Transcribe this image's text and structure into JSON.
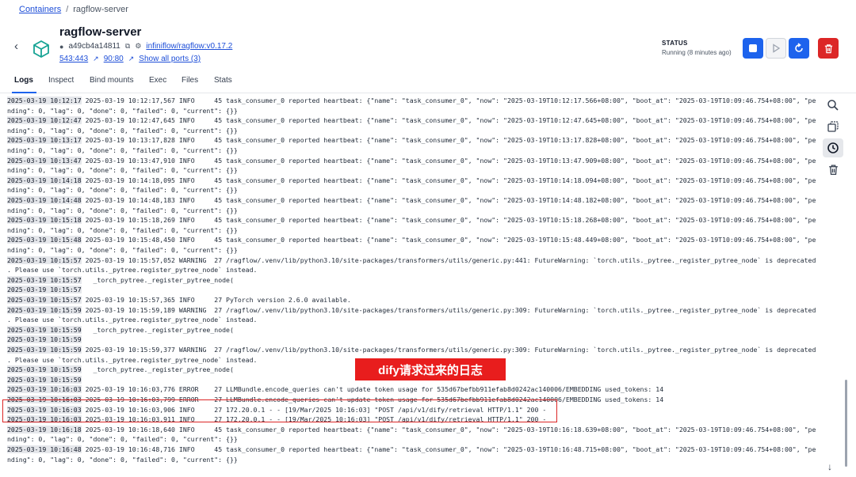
{
  "breadcrumb": {
    "parent": "Containers",
    "separator": "/",
    "current": "ragflow-server"
  },
  "header": {
    "title": "ragflow-server",
    "container_id": "a49cb4a14811",
    "image_link": "infiniflow/ragflow:v0.17.2",
    "port_1": "543:443",
    "port_2": "90:80",
    "show_all_ports": "Show all ports (3)"
  },
  "status": {
    "label": "STATUS",
    "value": "Running (8 minutes ago)"
  },
  "colors": {
    "primary": "#1d63ed",
    "danger": "#dc2626",
    "annotation_bg": "#e81d1d"
  },
  "tabs": [
    {
      "label": "Logs"
    },
    {
      "label": "Inspect"
    },
    {
      "label": "Bind mounts"
    },
    {
      "label": "Exec"
    },
    {
      "label": "Files"
    },
    {
      "label": "Stats"
    }
  ],
  "toolbar_icons": [
    "search-icon",
    "copy-icon",
    "clock-icon",
    "trash-icon"
  ],
  "annotation": "dify请求过来的日志",
  "logs": [
    {
      "ts": "2025-03-19 10:12:17",
      "text": " 2025-03-19 10:12:17,567 INFO     45 task_consumer_0 reported heartbeat: {\"name\": \"task_consumer_0\", \"now\": \"2025-03-19T10:12:17.566+08:00\", \"boot_at\": \"2025-03-19T10:09:46.754+08:00\", \"pe"
    },
    {
      "ts": "",
      "text": "nding\": 0, \"lag\": 0, \"done\": 0, \"failed\": 0, \"current\": {}}"
    },
    {
      "ts": "2025-03-19 10:12:47",
      "text": " 2025-03-19 10:12:47,645 INFO     45 task_consumer_0 reported heartbeat: {\"name\": \"task_consumer_0\", \"now\": \"2025-03-19T10:12:47.645+08:00\", \"boot_at\": \"2025-03-19T10:09:46.754+08:00\", \"pe"
    },
    {
      "ts": "",
      "text": "nding\": 0, \"lag\": 0, \"done\": 0, \"failed\": 0, \"current\": {}}"
    },
    {
      "ts": "2025-03-19 10:13:17",
      "text": " 2025-03-19 10:13:17,828 INFO     45 task_consumer_0 reported heartbeat: {\"name\": \"task_consumer_0\", \"now\": \"2025-03-19T10:13:17.828+08:00\", \"boot_at\": \"2025-03-19T10:09:46.754+08:00\", \"pe"
    },
    {
      "ts": "",
      "text": "nding\": 0, \"lag\": 0, \"done\": 0, \"failed\": 0, \"current\": {}}"
    },
    {
      "ts": "2025-03-19 10:13:47",
      "text": " 2025-03-19 10:13:47,910 INFO     45 task_consumer_0 reported heartbeat: {\"name\": \"task_consumer_0\", \"now\": \"2025-03-19T10:13:47.909+08:00\", \"boot_at\": \"2025-03-19T10:09:46.754+08:00\", \"pe"
    },
    {
      "ts": "",
      "text": "nding\": 0, \"lag\": 0, \"done\": 0, \"failed\": 0, \"current\": {}}"
    },
    {
      "ts": "2025-03-19 10:14:18",
      "text": " 2025-03-19 10:14:18,095 INFO     45 task_consumer_0 reported heartbeat: {\"name\": \"task_consumer_0\", \"now\": \"2025-03-19T10:14:18.094+08:00\", \"boot_at\": \"2025-03-19T10:09:46.754+08:00\", \"pe"
    },
    {
      "ts": "",
      "text": "nding\": 0, \"lag\": 0, \"done\": 0, \"failed\": 0, \"current\": {}}"
    },
    {
      "ts": "2025-03-19 10:14:48",
      "text": " 2025-03-19 10:14:48,183 INFO     45 task_consumer_0 reported heartbeat: {\"name\": \"task_consumer_0\", \"now\": \"2025-03-19T10:14:48.182+08:00\", \"boot_at\": \"2025-03-19T10:09:46.754+08:00\", \"pe"
    },
    {
      "ts": "",
      "text": "nding\": 0, \"lag\": 0, \"done\": 0, \"failed\": 0, \"current\": {}}"
    },
    {
      "ts": "2025-03-19 10:15:18",
      "text": " 2025-03-19 10:15:18,269 INFO     45 task_consumer_0 reported heartbeat: {\"name\": \"task_consumer_0\", \"now\": \"2025-03-19T10:15:18.268+08:00\", \"boot_at\": \"2025-03-19T10:09:46.754+08:00\", \"pe"
    },
    {
      "ts": "",
      "text": "nding\": 0, \"lag\": 0, \"done\": 0, \"failed\": 0, \"current\": {}}"
    },
    {
      "ts": "2025-03-19 10:15:48",
      "text": " 2025-03-19 10:15:48,450 INFO     45 task_consumer_0 reported heartbeat: {\"name\": \"task_consumer_0\", \"now\": \"2025-03-19T10:15:48.449+08:00\", \"boot_at\": \"2025-03-19T10:09:46.754+08:00\", \"pe"
    },
    {
      "ts": "",
      "text": "nding\": 0, \"lag\": 0, \"done\": 0, \"failed\": 0, \"current\": {}}"
    },
    {
      "ts": "2025-03-19 10:15:57",
      "text": " 2025-03-19 10:15:57,052 WARNING  27 /ragflow/.venv/lib/python3.10/site-packages/transformers/utils/generic.py:441: FutureWarning: `torch.utils._pytree._register_pytree_node` is deprecated"
    },
    {
      "ts": "",
      "text": ". Please use `torch.utils._pytree.register_pytree_node` instead."
    },
    {
      "ts": "2025-03-19 10:15:57",
      "text": "   _torch_pytree._register_pytree_node("
    },
    {
      "ts": "2025-03-19 10:15:57",
      "text": ""
    },
    {
      "ts": "2025-03-19 10:15:57",
      "text": " 2025-03-19 10:15:57,365 INFO     27 PyTorch version 2.6.0 available."
    },
    {
      "ts": "2025-03-19 10:15:59",
      "text": " 2025-03-19 10:15:59,189 WARNING  27 /ragflow/.venv/lib/python3.10/site-packages/transformers/utils/generic.py:309: FutureWarning: `torch.utils._pytree._register_pytree_node` is deprecated"
    },
    {
      "ts": "",
      "text": ". Please use `torch.utils._pytree.register_pytree_node` instead."
    },
    {
      "ts": "2025-03-19 10:15:59",
      "text": "   _torch_pytree._register_pytree_node("
    },
    {
      "ts": "2025-03-19 10:15:59",
      "text": ""
    },
    {
      "ts": "2025-03-19 10:15:59",
      "text": " 2025-03-19 10:15:59,377 WARNING  27 /ragflow/.venv/lib/python3.10/site-packages/transformers/utils/generic.py:309: FutureWarning: `torch.utils._pytree._register_pytree_node` is deprecated"
    },
    {
      "ts": "",
      "text": ". Please use `torch.utils._pytree.register_pytree_node` instead."
    },
    {
      "ts": "2025-03-19 10:15:59",
      "text": "   _torch_pytree._register_pytree_node("
    },
    {
      "ts": "2025-03-19 10:15:59",
      "text": ""
    },
    {
      "ts": "2025-03-19 10:16:03",
      "text": " 2025-03-19 10:16:03,776 ERROR    27 LLMBundle.encode_queries can't update token usage for 535d67befbb911efab8d0242ac140006/EMBEDDING used_tokens: 14"
    },
    {
      "ts": "2025-03-19 10:16:03",
      "text": " 2025-03-19 10:16:03,799 ERROR    27 LLMBundle.encode_queries can't update token usage for 535d67befbb911efab8d0242ac140006/EMBEDDING used_tokens: 14"
    },
    {
      "ts": "2025-03-19 10:16:03",
      "text": " 2025-03-19 10:16:03,906 INFO     27 172.20.0.1 - - [19/Mar/2025 10:16:03] \"POST /api/v1/dify/retrieval HTTP/1.1\" 200 -"
    },
    {
      "ts": "2025-03-19 10:16:03",
      "text": " 2025-03-19 10:16:03,911 INFO     27 172.20.0.1 - - [19/Mar/2025 10:16:03] \"POST /api/v1/dify/retrieval HTTP/1.1\" 200 -"
    },
    {
      "ts": "2025-03-19 10:16:18",
      "text": " 2025-03-19 10:16:18,640 INFO     45 task_consumer_0 reported heartbeat: {\"name\": \"task_consumer_0\", \"now\": \"2025-03-19T10:16:18.639+08:00\", \"boot_at\": \"2025-03-19T10:09:46.754+08:00\", \"pe"
    },
    {
      "ts": "",
      "text": "nding\": 0, \"lag\": 0, \"done\": 0, \"failed\": 0, \"current\": {}}"
    },
    {
      "ts": "2025-03-19 10:16:48",
      "text": " 2025-03-19 10:16:48,716 INFO     45 task_consumer_0 reported heartbeat: {\"name\": \"task_consumer_0\", \"now\": \"2025-03-19T10:16:48.715+08:00\", \"boot_at\": \"2025-03-19T10:09:46.754+08:00\", \"pe"
    },
    {
      "ts": "",
      "text": "nding\": 0, \"lag\": 0, \"done\": 0, \"failed\": 0, \"current\": {}}"
    }
  ]
}
